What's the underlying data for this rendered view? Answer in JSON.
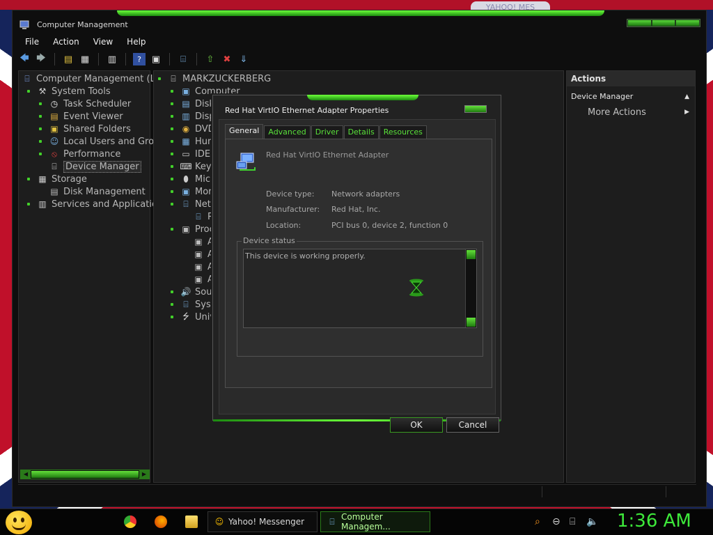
{
  "wallpaper": {
    "ghost_text": "YAHOO! MES"
  },
  "window": {
    "title": "Computer Management",
    "menu": [
      "File",
      "Action",
      "View",
      "Help"
    ],
    "toolbar_icons": [
      "back-icon",
      "forward-icon",
      "up-folder-icon",
      "show-hide-console-tree-icon",
      "properties-icon",
      "help-icon",
      "action-pane-icon",
      "scan-hardware-icon",
      "update-driver-icon",
      "uninstall-device-icon",
      "disable-device-icon"
    ]
  },
  "left_tree": {
    "root": "Computer Management (Loc",
    "items": [
      {
        "label": "System Tools",
        "level": 1,
        "icon": "tools-icon"
      },
      {
        "label": "Task Scheduler",
        "level": 2,
        "icon": "clock-icon"
      },
      {
        "label": "Event Viewer",
        "level": 2,
        "icon": "event-viewer-icon"
      },
      {
        "label": "Shared Folders",
        "level": 2,
        "icon": "shared-folder-icon"
      },
      {
        "label": "Local Users and Grou",
        "level": 2,
        "icon": "users-icon"
      },
      {
        "label": "Performance",
        "level": 2,
        "icon": "performance-icon"
      },
      {
        "label": "Device Manager",
        "level": 2,
        "icon": "device-manager-icon",
        "selected": true
      },
      {
        "label": "Storage",
        "level": 1,
        "icon": "storage-icon"
      },
      {
        "label": "Disk Management",
        "level": 2,
        "icon": "disk-icon"
      },
      {
        "label": "Services and Applications",
        "level": 1,
        "icon": "services-icon"
      }
    ]
  },
  "device_tree": {
    "root": "MARKZUCKERBERG",
    "items": [
      {
        "label": "Computer",
        "level": 1
      },
      {
        "label": "Disk",
        "level": 1
      },
      {
        "label": "Disp",
        "level": 1
      },
      {
        "label": "DVD",
        "level": 1
      },
      {
        "label": "Hum",
        "level": 1
      },
      {
        "label": "IDE",
        "level": 1
      },
      {
        "label": "Key",
        "level": 1
      },
      {
        "label": "Mic",
        "level": 1
      },
      {
        "label": "Mon",
        "level": 1
      },
      {
        "label": "Netw",
        "level": 1
      },
      {
        "label": "R",
        "level": 2
      },
      {
        "label": "Proc",
        "level": 1
      },
      {
        "label": "A",
        "level": 2
      },
      {
        "label": "A",
        "level": 2
      },
      {
        "label": "A",
        "level": 2
      },
      {
        "label": "A",
        "level": 2
      },
      {
        "label": "Sou",
        "level": 1
      },
      {
        "label": "Sys",
        "level": 1
      },
      {
        "label": "Univ",
        "level": 1
      }
    ]
  },
  "actions": {
    "header": "Actions",
    "section": "Device Manager",
    "more": "More Actions"
  },
  "dialog": {
    "title": "Red Hat VirtIO Ethernet Adapter Properties",
    "tabs": [
      "General",
      "Advanced",
      "Driver",
      "Details",
      "Resources"
    ],
    "active_tab": "General",
    "device_name": "Red Hat VirtIO Ethernet Adapter",
    "fields": [
      {
        "label": "Device type:",
        "value": "Network adapters"
      },
      {
        "label": "Manufacturer:",
        "value": "Red Hat, Inc."
      },
      {
        "label": "Location:",
        "value": "PCI bus 0, device 2, function 0"
      }
    ],
    "status_group": "Device status",
    "status_text": "This device is working properly.",
    "ok": "OK",
    "cancel": "Cancel"
  },
  "taskbar": {
    "tasks": [
      {
        "label": "Yahoo! Messenger",
        "active": false
      },
      {
        "label": "Computer Managem...",
        "active": true
      }
    ],
    "clock": "1:36 AM",
    "tray_icons": [
      "search-icon",
      "volume-minus-icon",
      "network-icon",
      "speaker-icon"
    ],
    "accent": "#3de83a"
  }
}
